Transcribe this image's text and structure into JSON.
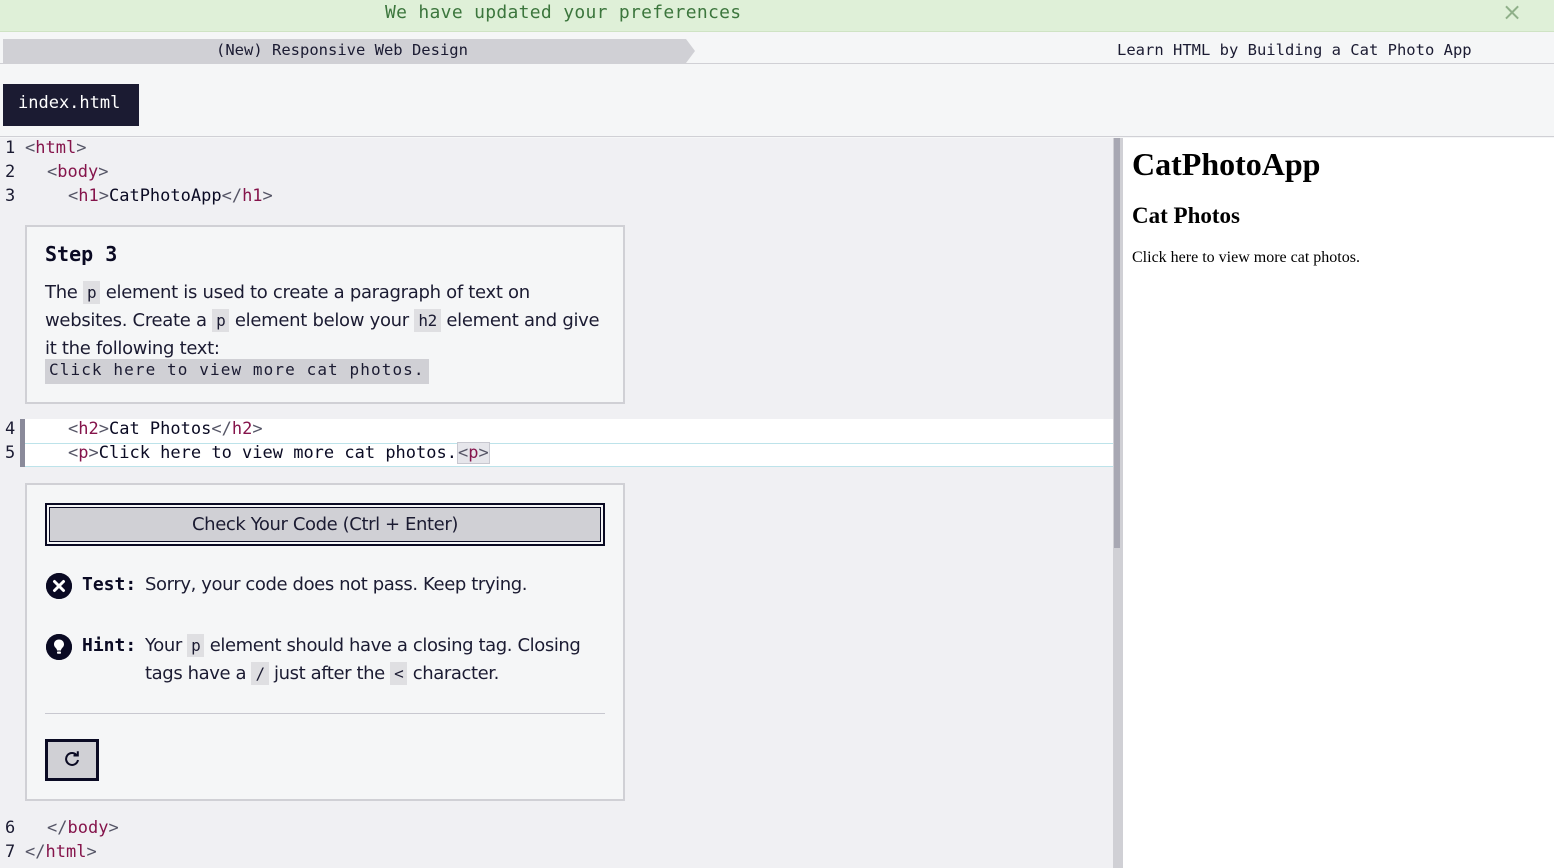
{
  "flash": {
    "message": "We have updated your preferences",
    "close_glyph": "×"
  },
  "breadcrumb": {
    "superblock": "(New) Responsive Web Design",
    "block": "Learn HTML by Building a Cat Photo App"
  },
  "editor": {
    "file_tab": "index.html",
    "lines": [
      {
        "num": "1",
        "open": "<",
        "tag": "html",
        "close": ">"
      },
      {
        "num": "2",
        "open": "<",
        "tag": "body",
        "close": ">"
      },
      {
        "num": "3",
        "open": "<",
        "tag": "h1",
        "close": ">",
        "text": "CatPhotoApp",
        "end_open": "</",
        "end_tag": "h1",
        "end_close": ">"
      },
      {
        "num": "4",
        "open": "<",
        "tag": "h2",
        "close": ">",
        "text": "Cat Photos",
        "end_open": "</",
        "end_tag": "h2",
        "end_close": ">"
      },
      {
        "num": "5",
        "open": "<",
        "tag": "p",
        "close": ">",
        "text": "Click here to view more cat photos.",
        "end_open": "<",
        "end_tag": "p",
        "end_close": ">"
      },
      {
        "num": "6",
        "open": "</",
        "tag": "body",
        "close": ">"
      },
      {
        "num": "7",
        "open": "</",
        "tag": "html",
        "close": ">"
      }
    ]
  },
  "description": {
    "step_title": "Step 3",
    "text_1": "The ",
    "code_1": "p",
    "text_2": " element is used to create a paragraph of text on websites. Create a ",
    "code_2": "p",
    "text_3": " element below your ",
    "code_3": "h2",
    "text_4": " element and give it the following text:",
    "seed_text": "Click here to view more cat photos."
  },
  "tests": {
    "check_button": "Check Your Code (Ctrl + Enter)",
    "test_label": "Test:",
    "test_message": "Sorry, your code does not pass. Keep trying.",
    "hint_label": "Hint:",
    "hint_1": "Your ",
    "hint_code_1": "p",
    "hint_2": " element should have a closing tag. Closing tags have a ",
    "hint_code_2": "/",
    "hint_3": " just after the ",
    "hint_code_3": "<",
    "hint_4": " character.",
    "reset_glyph": "↻"
  },
  "preview": {
    "h1": "CatPhotoApp",
    "h2": "Cat Photos",
    "p": "Click here to view more cat photos."
  }
}
